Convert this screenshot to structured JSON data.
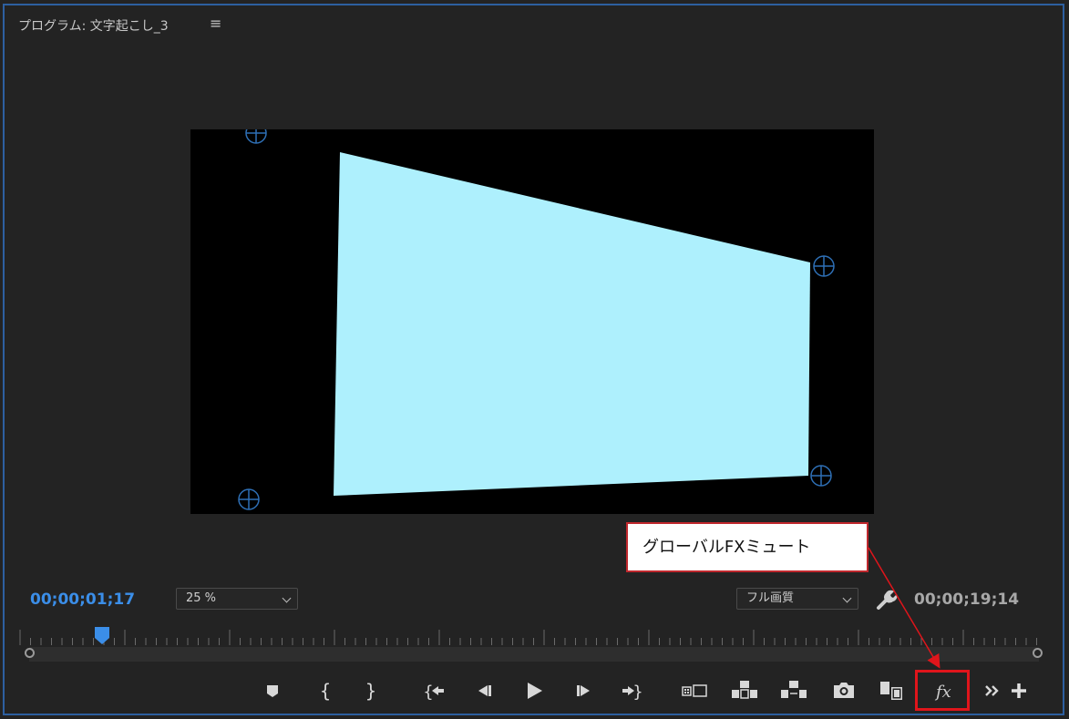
{
  "panel": {
    "title": "プログラム: 文字起こし_3",
    "menu_glyph": "≡"
  },
  "monitor": {
    "background": "#000000",
    "shape_fill": "#aef0fd",
    "corner_pin_color": "#2e6fb5"
  },
  "controls": {
    "current_timecode": "00;00;01;17",
    "duration_timecode": "00;00;19;14",
    "zoom": "25 %",
    "quality": "フル画質",
    "accent": "#3b8ee8"
  },
  "transport": [
    {
      "icon": "marker-icon",
      "label": "マーカーを追加"
    },
    {
      "icon": "mark-in-icon",
      "label": "インをマーク"
    },
    {
      "icon": "mark-out-icon",
      "label": "アウトをマーク"
    },
    {
      "icon": "go-to-in-icon",
      "label": "インへ移動"
    },
    {
      "icon": "step-back-icon",
      "label": "1 フレーム前へ戻る"
    },
    {
      "icon": "play-icon",
      "label": "再生"
    },
    {
      "icon": "step-forward-icon",
      "label": "1 フレーム先へ進む"
    },
    {
      "icon": "go-to-out-icon",
      "label": "アウトへ移動"
    },
    {
      "icon": "comparison-view-icon",
      "label": "比較表示"
    },
    {
      "icon": "lift-icon",
      "label": "リフト"
    },
    {
      "icon": "extract-icon",
      "label": "抽出"
    },
    {
      "icon": "camera-icon",
      "label": "フレームを書き出し"
    },
    {
      "icon": "multicam-icon",
      "label": "マルチカメラ"
    },
    {
      "icon": "fx-icon",
      "label": "fx"
    },
    {
      "icon": "more-icon",
      "label": "»"
    },
    {
      "icon": "add-icon",
      "label": "+"
    }
  ],
  "fx_label": "fx",
  "annotation": {
    "text": "グローバルFXミュート",
    "color": "#e0151b"
  }
}
